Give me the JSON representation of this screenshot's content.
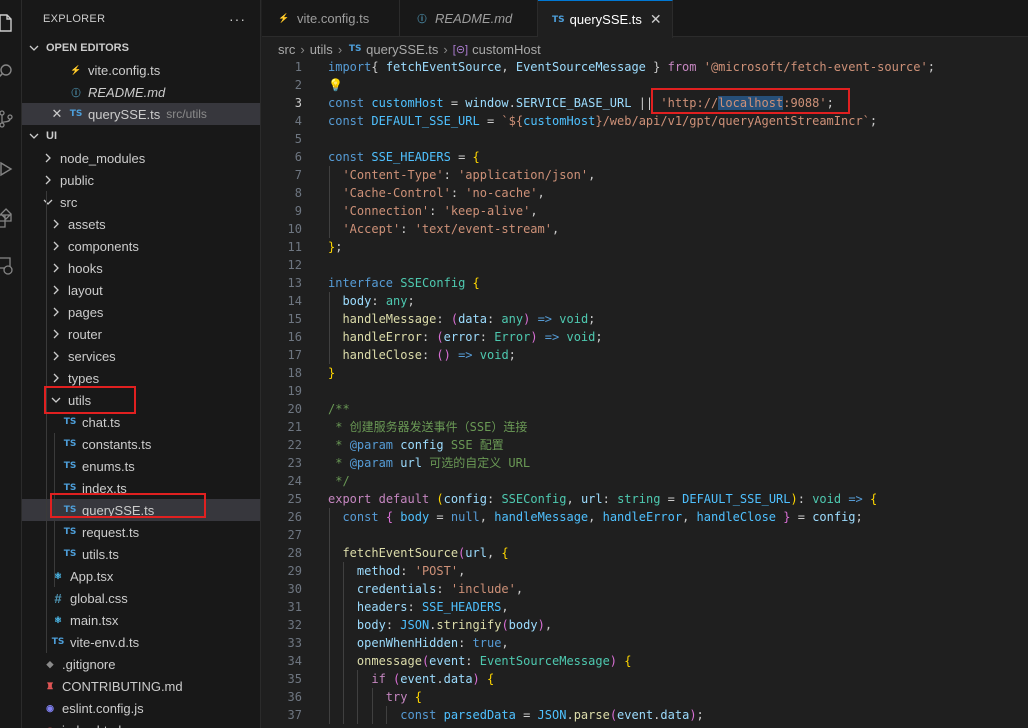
{
  "activity_icons": [
    "files-icon",
    "search-icon",
    "source-control-icon",
    "run-debug-icon",
    "extensions-icon",
    "remote-explorer-icon"
  ],
  "sidebar": {
    "title": "EXPLORER",
    "more": "···",
    "open_editors_label": "OPEN EDITORS",
    "open_editors": [
      {
        "name": "vite.config.ts",
        "icon": "vite-icon",
        "italic": false,
        "path": ""
      },
      {
        "name": "README.md",
        "icon": "info-icon",
        "italic": true,
        "path": ""
      },
      {
        "name": "querySSE.ts",
        "icon": "ts-icon",
        "italic": false,
        "path": "src/utils"
      }
    ],
    "project_label": "UI",
    "tree": [
      {
        "name": "node_modules",
        "type": "folder",
        "depth": 0
      },
      {
        "name": "public",
        "type": "folder",
        "depth": 0
      },
      {
        "name": "src",
        "type": "folder-open",
        "depth": 0
      },
      {
        "name": "assets",
        "type": "folder",
        "depth": 1
      },
      {
        "name": "components",
        "type": "folder",
        "depth": 1
      },
      {
        "name": "hooks",
        "type": "folder",
        "depth": 1
      },
      {
        "name": "layout",
        "type": "folder",
        "depth": 1
      },
      {
        "name": "pages",
        "type": "folder",
        "depth": 1
      },
      {
        "name": "router",
        "type": "folder",
        "depth": 1
      },
      {
        "name": "services",
        "type": "folder",
        "depth": 1
      },
      {
        "name": "types",
        "type": "folder",
        "depth": 1
      },
      {
        "name": "utils",
        "type": "folder-open",
        "depth": 1
      },
      {
        "name": "chat.ts",
        "type": "ts",
        "depth": 2
      },
      {
        "name": "constants.ts",
        "type": "ts",
        "depth": 2
      },
      {
        "name": "enums.ts",
        "type": "ts",
        "depth": 2
      },
      {
        "name": "index.ts",
        "type": "ts",
        "depth": 2
      },
      {
        "name": "querySSE.ts",
        "type": "ts",
        "depth": 2
      },
      {
        "name": "request.ts",
        "type": "ts",
        "depth": 2
      },
      {
        "name": "utils.ts",
        "type": "ts",
        "depth": 2
      },
      {
        "name": "App.tsx",
        "type": "react",
        "depth": 1
      },
      {
        "name": "global.css",
        "type": "css",
        "depth": 1
      },
      {
        "name": "main.tsx",
        "type": "react",
        "depth": 1
      },
      {
        "name": "vite-env.d.ts",
        "type": "ts",
        "depth": 1
      },
      {
        "name": ".gitignore",
        "type": "git",
        "depth": 0
      },
      {
        "name": "CONTRIBUTING.md",
        "type": "contrib",
        "depth": 0
      },
      {
        "name": "eslint.config.js",
        "type": "eslint",
        "depth": 0
      },
      {
        "name": "index.html",
        "type": "html",
        "depth": 0
      }
    ]
  },
  "tabs": [
    {
      "label": "vite.config.ts",
      "icon": "vite-icon",
      "italic": false,
      "active": false
    },
    {
      "label": "README.md",
      "icon": "info-icon",
      "italic": true,
      "active": false
    },
    {
      "label": "querySSE.ts",
      "icon": "ts-icon",
      "italic": false,
      "active": true
    }
  ],
  "breadcrumbs": [
    "src",
    "utils",
    "querySSE.ts",
    "customHost"
  ],
  "code": {
    "current_line": 3,
    "lines": [
      {
        "n": 1,
        "segs": [
          [
            "k",
            "import"
          ],
          [
            "",
            "{ "
          ],
          [
            "v",
            "fetchEventSource"
          ],
          [
            "",
            ", "
          ],
          [
            "v",
            "EventSourceMessage"
          ],
          [
            "",
            " } "
          ],
          [
            "kc",
            "from"
          ],
          [
            "",
            " "
          ],
          [
            "s",
            "'@microsoft/fetch-event-source'"
          ],
          [
            "",
            ";"
          ]
        ]
      },
      {
        "n": 2,
        "segs": [
          [
            "bulb",
            "💡"
          ]
        ]
      },
      {
        "n": 3,
        "segs": [
          [
            "k",
            "const"
          ],
          [
            "",
            " "
          ],
          [
            "c",
            "customHost"
          ],
          [
            "",
            " = "
          ],
          [
            "v",
            "window"
          ],
          [
            "",
            "."
          ],
          [
            "v",
            "SERVICE_BASE_URL"
          ],
          [
            "",
            " || "
          ],
          [
            "s",
            "'http://"
          ],
          [
            "s hl",
            "localhost"
          ],
          [
            "s",
            ":9088'"
          ],
          [
            "",
            ";"
          ]
        ]
      },
      {
        "n": 4,
        "segs": [
          [
            "k",
            "const"
          ],
          [
            "",
            " "
          ],
          [
            "c",
            "DEFAULT_SSE_URL"
          ],
          [
            "",
            " = "
          ],
          [
            "s",
            "`${"
          ],
          [
            "c",
            "customHost"
          ],
          [
            "s",
            "}/web/api/v1/gpt/queryAgentStreamIncr`"
          ],
          [
            "",
            ";"
          ]
        ]
      },
      {
        "n": 5,
        "segs": []
      },
      {
        "n": 6,
        "segs": [
          [
            "k",
            "const"
          ],
          [
            "",
            " "
          ],
          [
            "c",
            "SSE_HEADERS"
          ],
          [
            "",
            " = "
          ],
          [
            "p",
            "{"
          ]
        ]
      },
      {
        "n": 7,
        "segs": [
          [
            "",
            "  "
          ],
          [
            "s",
            "'Content-Type'"
          ],
          [
            "",
            ": "
          ],
          [
            "s",
            "'application/json'"
          ],
          [
            "",
            ","
          ]
        ]
      },
      {
        "n": 8,
        "segs": [
          [
            "",
            "  "
          ],
          [
            "s",
            "'Cache-Control'"
          ],
          [
            "",
            ": "
          ],
          [
            "s",
            "'no-cache'"
          ],
          [
            "",
            ","
          ]
        ]
      },
      {
        "n": 9,
        "segs": [
          [
            "",
            "  "
          ],
          [
            "s",
            "'Connection'"
          ],
          [
            "",
            ": "
          ],
          [
            "s",
            "'keep-alive'"
          ],
          [
            "",
            ","
          ]
        ]
      },
      {
        "n": 10,
        "segs": [
          [
            "",
            "  "
          ],
          [
            "s",
            "'Accept'"
          ],
          [
            "",
            ": "
          ],
          [
            "s",
            "'text/event-stream'"
          ],
          [
            "",
            ","
          ]
        ]
      },
      {
        "n": 11,
        "segs": [
          [
            "p",
            "}"
          ],
          [
            "",
            ";"
          ]
        ]
      },
      {
        "n": 12,
        "segs": []
      },
      {
        "n": 13,
        "segs": [
          [
            "k",
            "interface"
          ],
          [
            "",
            " "
          ],
          [
            "t",
            "SSEConfig"
          ],
          [
            "",
            " "
          ],
          [
            "p",
            "{"
          ]
        ]
      },
      {
        "n": 14,
        "segs": [
          [
            "",
            "  "
          ],
          [
            "v",
            "body"
          ],
          [
            "",
            ": "
          ],
          [
            "t",
            "any"
          ],
          [
            "",
            ";"
          ]
        ]
      },
      {
        "n": 15,
        "segs": [
          [
            "",
            "  "
          ],
          [
            "f",
            "handleMessage"
          ],
          [
            "",
            ": "
          ],
          [
            "p2",
            "("
          ],
          [
            "v",
            "data"
          ],
          [
            "",
            ": "
          ],
          [
            "t",
            "any"
          ],
          [
            "p2",
            ")"
          ],
          [
            "",
            " "
          ],
          [
            "k",
            "=>"
          ],
          [
            "",
            " "
          ],
          [
            "t",
            "void"
          ],
          [
            "",
            ";"
          ]
        ]
      },
      {
        "n": 16,
        "segs": [
          [
            "",
            "  "
          ],
          [
            "f",
            "handleError"
          ],
          [
            "",
            ": "
          ],
          [
            "p2",
            "("
          ],
          [
            "v",
            "error"
          ],
          [
            "",
            ": "
          ],
          [
            "t",
            "Error"
          ],
          [
            "p2",
            ")"
          ],
          [
            "",
            " "
          ],
          [
            "k",
            "=>"
          ],
          [
            "",
            " "
          ],
          [
            "t",
            "void"
          ],
          [
            "",
            ";"
          ]
        ]
      },
      {
        "n": 17,
        "segs": [
          [
            "",
            "  "
          ],
          [
            "f",
            "handleClose"
          ],
          [
            "",
            ": "
          ],
          [
            "p2",
            "()"
          ],
          [
            "",
            " "
          ],
          [
            "k",
            "=>"
          ],
          [
            "",
            " "
          ],
          [
            "t",
            "void"
          ],
          [
            "",
            ";"
          ]
        ]
      },
      {
        "n": 18,
        "segs": [
          [
            "p",
            "}"
          ]
        ]
      },
      {
        "n": 19,
        "segs": []
      },
      {
        "n": 20,
        "segs": [
          [
            "cm",
            "/**"
          ]
        ]
      },
      {
        "n": 21,
        "segs": [
          [
            "cm",
            " * 创建服务器发送事件（SSE）连接"
          ]
        ]
      },
      {
        "n": 22,
        "segs": [
          [
            "cm",
            " * "
          ],
          [
            "k",
            "@param"
          ],
          [
            "",
            " "
          ],
          [
            "v",
            "config"
          ],
          [
            "cm",
            " SSE 配置"
          ]
        ]
      },
      {
        "n": 23,
        "segs": [
          [
            "cm",
            " * "
          ],
          [
            "k",
            "@param"
          ],
          [
            "",
            " "
          ],
          [
            "v",
            "url"
          ],
          [
            "cm",
            " 可选的自定义 URL"
          ]
        ]
      },
      {
        "n": 24,
        "segs": [
          [
            "cm",
            " */"
          ]
        ]
      },
      {
        "n": 25,
        "segs": [
          [
            "kc",
            "export"
          ],
          [
            "",
            " "
          ],
          [
            "kc",
            "default"
          ],
          [
            "",
            " "
          ],
          [
            "p",
            "("
          ],
          [
            "v",
            "config"
          ],
          [
            "",
            ": "
          ],
          [
            "t",
            "SSEConfig"
          ],
          [
            "",
            ", "
          ],
          [
            "v",
            "url"
          ],
          [
            "",
            ": "
          ],
          [
            "t",
            "string"
          ],
          [
            "",
            " = "
          ],
          [
            "c",
            "DEFAULT_SSE_URL"
          ],
          [
            "p",
            ")"
          ],
          [
            "",
            ": "
          ],
          [
            "t",
            "void"
          ],
          [
            "",
            " "
          ],
          [
            "k",
            "=>"
          ],
          [
            "",
            " "
          ],
          [
            "p",
            "{"
          ]
        ]
      },
      {
        "n": 26,
        "segs": [
          [
            "",
            "  "
          ],
          [
            "k",
            "const"
          ],
          [
            "",
            " "
          ],
          [
            "p2",
            "{"
          ],
          [
            "",
            " "
          ],
          [
            "c",
            "body"
          ],
          [
            "",
            " = "
          ],
          [
            "k",
            "null"
          ],
          [
            "",
            ", "
          ],
          [
            "c",
            "handleMessage"
          ],
          [
            "",
            ", "
          ],
          [
            "c",
            "handleError"
          ],
          [
            "",
            ", "
          ],
          [
            "c",
            "handleClose"
          ],
          [
            "",
            " "
          ],
          [
            "p2",
            "}"
          ],
          [
            "",
            " = "
          ],
          [
            "v",
            "config"
          ],
          [
            "",
            ";"
          ]
        ]
      },
      {
        "n": 27,
        "segs": []
      },
      {
        "n": 28,
        "segs": [
          [
            "",
            "  "
          ],
          [
            "f",
            "fetchEventSource"
          ],
          [
            "p2",
            "("
          ],
          [
            "v",
            "url"
          ],
          [
            "",
            ", "
          ],
          [
            "p",
            "{"
          ]
        ]
      },
      {
        "n": 29,
        "segs": [
          [
            "",
            "    "
          ],
          [
            "v",
            "method"
          ],
          [
            "",
            ": "
          ],
          [
            "s",
            "'POST'"
          ],
          [
            "",
            ","
          ]
        ]
      },
      {
        "n": 30,
        "segs": [
          [
            "",
            "    "
          ],
          [
            "v",
            "credentials"
          ],
          [
            "",
            ": "
          ],
          [
            "s",
            "'include'"
          ],
          [
            "",
            ","
          ]
        ]
      },
      {
        "n": 31,
        "segs": [
          [
            "",
            "    "
          ],
          [
            "v",
            "headers"
          ],
          [
            "",
            ": "
          ],
          [
            "c",
            "SSE_HEADERS"
          ],
          [
            "",
            ","
          ]
        ]
      },
      {
        "n": 32,
        "segs": [
          [
            "",
            "    "
          ],
          [
            "v",
            "body"
          ],
          [
            "",
            ": "
          ],
          [
            "c",
            "JSON"
          ],
          [
            "",
            "."
          ],
          [
            "f",
            "stringify"
          ],
          [
            "p2",
            "("
          ],
          [
            "v",
            "body"
          ],
          [
            "p2",
            ")"
          ],
          [
            "",
            ","
          ]
        ]
      },
      {
        "n": 33,
        "segs": [
          [
            "",
            "    "
          ],
          [
            "v",
            "openWhenHidden"
          ],
          [
            "",
            ": "
          ],
          [
            "k",
            "true"
          ],
          [
            "",
            ","
          ]
        ]
      },
      {
        "n": 34,
        "segs": [
          [
            "",
            "    "
          ],
          [
            "f",
            "onmessage"
          ],
          [
            "p2",
            "("
          ],
          [
            "v",
            "event"
          ],
          [
            "",
            ": "
          ],
          [
            "t",
            "EventSourceMessage"
          ],
          [
            "p2",
            ")"
          ],
          [
            "",
            " "
          ],
          [
            "p",
            "{"
          ]
        ]
      },
      {
        "n": 35,
        "segs": [
          [
            "",
            "      "
          ],
          [
            "kc",
            "if"
          ],
          [
            "",
            " "
          ],
          [
            "p2",
            "("
          ],
          [
            "v",
            "event"
          ],
          [
            "",
            "."
          ],
          [
            "v",
            "data"
          ],
          [
            "p2",
            ")"
          ],
          [
            "",
            " "
          ],
          [
            "p",
            "{"
          ]
        ]
      },
      {
        "n": 36,
        "segs": [
          [
            "",
            "        "
          ],
          [
            "kc",
            "try"
          ],
          [
            "",
            " "
          ],
          [
            "p",
            "{"
          ]
        ]
      },
      {
        "n": 37,
        "segs": [
          [
            "",
            "          "
          ],
          [
            "k",
            "const"
          ],
          [
            "",
            " "
          ],
          [
            "c",
            "parsedData"
          ],
          [
            "",
            " = "
          ],
          [
            "c",
            "JSON"
          ],
          [
            "",
            "."
          ],
          [
            "f",
            "parse"
          ],
          [
            "p2",
            "("
          ],
          [
            "v",
            "event"
          ],
          [
            "",
            "."
          ],
          [
            "v",
            "data"
          ],
          [
            "p2",
            ")"
          ],
          [
            "",
            ";"
          ]
        ]
      }
    ]
  }
}
